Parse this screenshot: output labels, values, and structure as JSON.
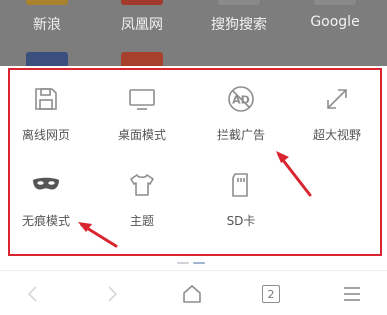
{
  "bookmarks": [
    {
      "label": "新浪"
    },
    {
      "label": "凤凰网"
    },
    {
      "label": "搜狗搜索"
    },
    {
      "label": "Google"
    }
  ],
  "menu": {
    "items": [
      {
        "label": "离线网页",
        "icon": "save-page-icon"
      },
      {
        "label": "桌面模式",
        "icon": "monitor-icon"
      },
      {
        "label": "拦截广告",
        "icon": "ad-block-icon"
      },
      {
        "label": "超大视野",
        "icon": "expand-icon"
      },
      {
        "label": "无痕模式",
        "icon": "mask-icon"
      },
      {
        "label": "主题",
        "icon": "tshirt-icon"
      },
      {
        "label": "SD卡",
        "icon": "sd-card-icon"
      }
    ]
  },
  "toolbar": {
    "tab_count": "2"
  },
  "colors": {
    "highlight_border": "#d9252f",
    "annotation_arrow": "#d9252f",
    "icon": "#8e8e8e"
  }
}
